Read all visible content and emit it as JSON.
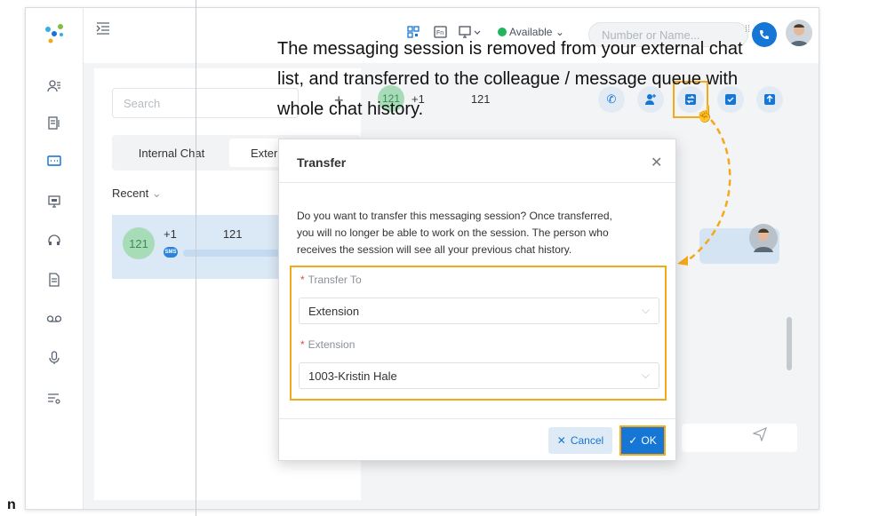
{
  "instruction": {
    "ok_word": "OK",
    "line1": "The messaging session is removed from your external chat",
    "line2": "list, and transferred to the colleague / message queue with",
    "line3": "whole chat history.",
    "step_label": "n"
  },
  "topbar": {
    "status": "Available",
    "number_placeholder": "Number or Name..."
  },
  "list": {
    "search_placeholder": "Search",
    "tab_internal": "Internal Chat",
    "tab_external": "Extern",
    "recent": "Recent",
    "conversation": {
      "avatar": "121",
      "name": "+1    121",
      "badge": "SMS"
    }
  },
  "chat": {
    "avatar": "121",
    "name": "+1    121"
  },
  "dialog": {
    "title": "Transfer",
    "message_l1": "Do you want to transfer this messaging session? Once transferred,",
    "message_l2": "you will no longer be able to work on the session. The person who",
    "message_l3": "receives the session will see all your previous chat history.",
    "transfer_to_label": "Transfer To",
    "transfer_to_value": "Extension",
    "extension_label": "Extension",
    "extension_value": "1003-Kristin Hale",
    "cancel_label": "Cancel",
    "ok_label": "OK"
  },
  "colors": {
    "brand": "#1576d6",
    "highlight": "#f4a91a",
    "status_available": "#21b55f"
  }
}
